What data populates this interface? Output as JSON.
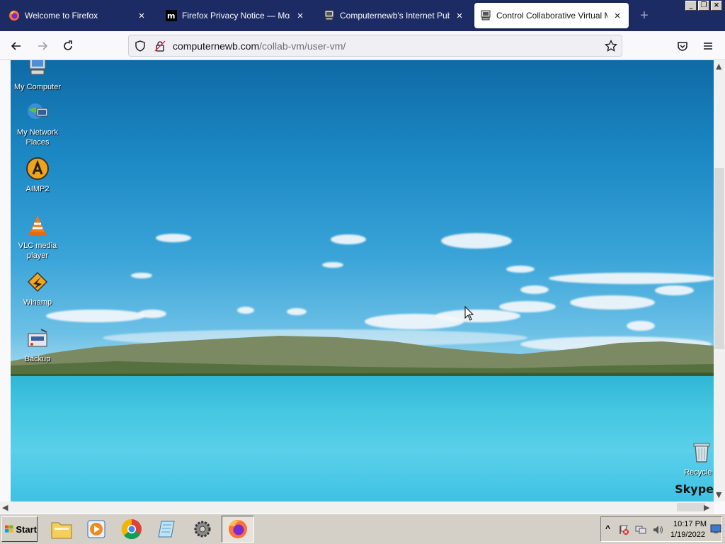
{
  "tabs": [
    {
      "title": "Welcome to Firefox",
      "close": "×",
      "active": false,
      "icon": "firefox-icon"
    },
    {
      "title": "Firefox Privacy Notice — Mozilla",
      "close": "×",
      "active": false,
      "icon": "mozilla-m-icon"
    },
    {
      "title": "Computernewb's Internet Pub Hub",
      "close": "×",
      "active": false,
      "icon": "computer-icon"
    },
    {
      "title": "Control Collaborative Virtual Machi",
      "close": "×",
      "active": true,
      "icon": "computer-icon"
    }
  ],
  "new_tab_label": "+",
  "window_controls": {
    "minimize": "_",
    "restore": "❐",
    "close": "×"
  },
  "address_bar": {
    "domain": "computernewb.com",
    "path": "/collab-vm/user-vm/"
  },
  "desktop": {
    "icons": [
      {
        "label": "My Computer",
        "icon": "my-computer-icon"
      },
      {
        "label": "My Network Places",
        "icon": "network-places-icon"
      },
      {
        "label": "AIMP2",
        "icon": "aimp-icon"
      },
      {
        "label": "VLC media player",
        "icon": "vlc-icon"
      },
      {
        "label": "Winamp",
        "icon": "winamp-icon"
      },
      {
        "label": "Backup",
        "icon": "backup-icon"
      },
      {
        "label": "Recycle B",
        "icon": "recycle-bin-icon"
      }
    ],
    "watermark": "Skype"
  },
  "taskbar": {
    "start_label": "Start",
    "clock_time": "10:17 PM",
    "clock_date": "1/19/2022",
    "tray_expand": "^"
  },
  "colors": {
    "tabstrip": "#1c2b63",
    "taskbar": "#d4d0c8"
  }
}
